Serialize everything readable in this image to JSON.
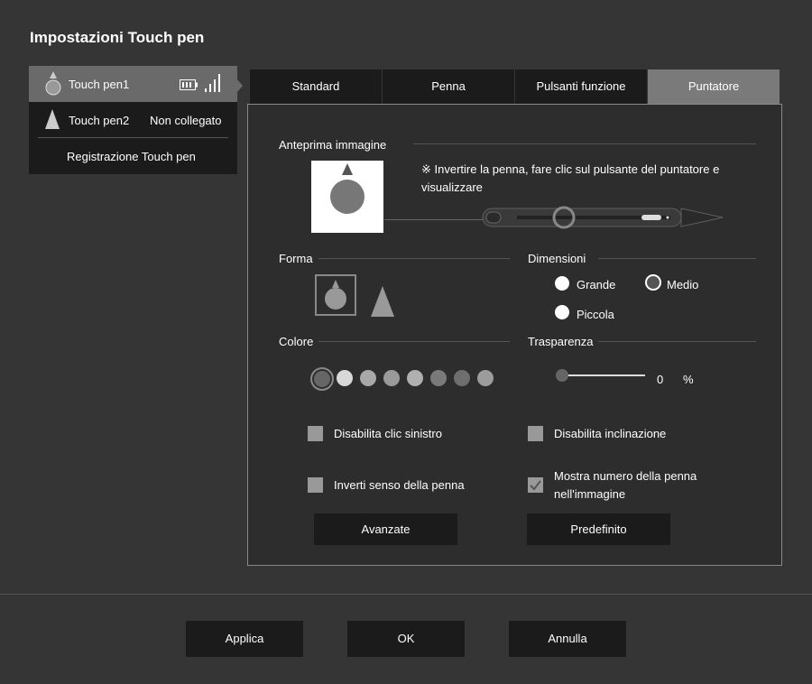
{
  "window": {
    "title": "Impostazioni Touch pen"
  },
  "sidebar": {
    "items": [
      {
        "label": "Touch pen1",
        "status": ""
      },
      {
        "label": "Touch pen2",
        "status": "Non collegato"
      },
      {
        "label": "Registrazione Touch pen"
      }
    ]
  },
  "tabs": [
    "Standard",
    "Penna",
    "Pulsanti funzione",
    "Puntatore"
  ],
  "preview": {
    "section": "Anteprima immagine",
    "note": "※ Invertire la penna, fare clic sul pulsante del puntatore e visualizzare"
  },
  "shape": {
    "section": "Forma"
  },
  "size": {
    "section": "Dimensioni",
    "options": [
      "Grande",
      "Medio",
      "Piccola"
    ],
    "selected": "Medio"
  },
  "color": {
    "section": "Colore",
    "swatches": [
      "#666666",
      "#d8d8d8",
      "#a8a8a8",
      "#9a9a9a",
      "#b0b0b0",
      "#7a7a7a",
      "#6e6e6e",
      "#9c9c9c"
    ]
  },
  "transparency": {
    "section": "Trasparenza",
    "value": "0",
    "unit": "%"
  },
  "checkboxes": {
    "disable_left_click": "Disabilita clic sinistro",
    "disable_tilt": "Disabilita inclinazione",
    "invert_direction": "Inverti senso della penna",
    "show_pen_number": "Mostra numero della penna nell'immagine"
  },
  "buttons": {
    "advanced": "Avanzate",
    "default": "Predefinito",
    "apply": "Applica",
    "ok": "OK",
    "cancel": "Annulla"
  }
}
